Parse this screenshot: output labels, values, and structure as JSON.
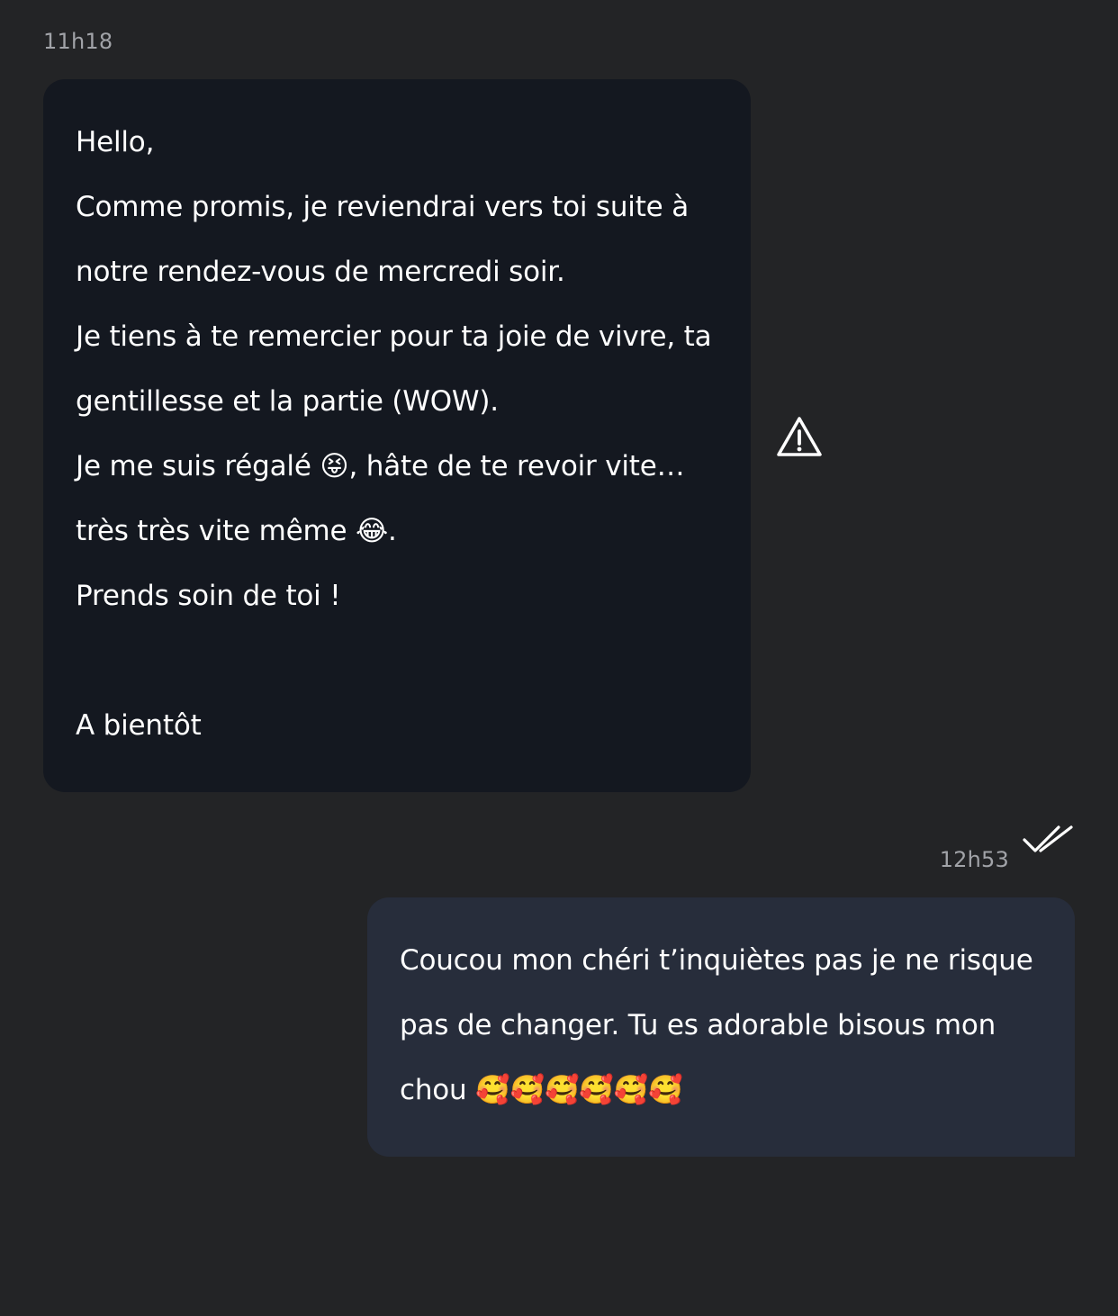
{
  "incoming": {
    "timestamp": "11h18",
    "lines": [
      "Hello,",
      "Comme promis, je reviendrai vers toi suite à",
      "notre rendez-vous de mercredi soir.",
      "Je tiens à te remercier pour ta joie de vivre, ta",
      "gentillesse et la partie (WOW).",
      "Je me suis régalé 😝, hâte de te revoir vite…",
      "très très vite même 😂.",
      "Prends soin de toi !",
      "",
      "A bientôt"
    ],
    "status_icon": "warning-triangle-icon"
  },
  "outgoing": {
    "timestamp": "12h53",
    "lines": [
      "Coucou mon chéri t’inquiètes pas je ne risque",
      "pas de changer. Tu es adorable bisous mon",
      "chou 🥰🥰🥰🥰🥰🥰"
    ],
    "status_icon": "double-check-icon"
  },
  "colors": {
    "background": "#232426",
    "incoming_bubble": "#141820",
    "outgoing_bubble": "#272d3b",
    "timestamp": "#a1a3a8",
    "text": "#ffffff"
  }
}
